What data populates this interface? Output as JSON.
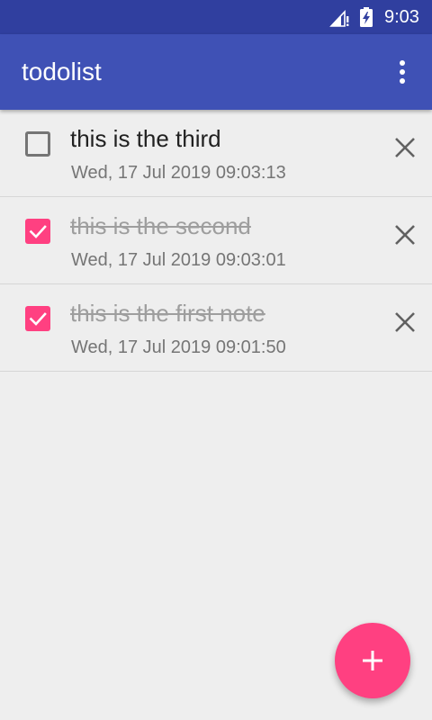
{
  "status_bar": {
    "time": "9:03",
    "icons": [
      "signal-icon",
      "battery-charging-icon"
    ]
  },
  "app_bar": {
    "title": "todolist",
    "overflow_icon": "more-vert-icon"
  },
  "todos": [
    {
      "text": "this is the third",
      "date": "Wed, 17 Jul 2019 09:03:13",
      "done": false
    },
    {
      "text": "this is the second",
      "date": "Wed, 17 Jul 2019 09:03:01",
      "done": true
    },
    {
      "text": "this is the first note",
      "date": "Wed, 17 Jul 2019 09:01:50",
      "done": true
    }
  ],
  "fab": {
    "icon": "plus-icon"
  },
  "colors": {
    "status_bar": "#303F9F",
    "primary": "#3F51B5",
    "accent": "#FF4081",
    "background": "#EEEEEE"
  }
}
